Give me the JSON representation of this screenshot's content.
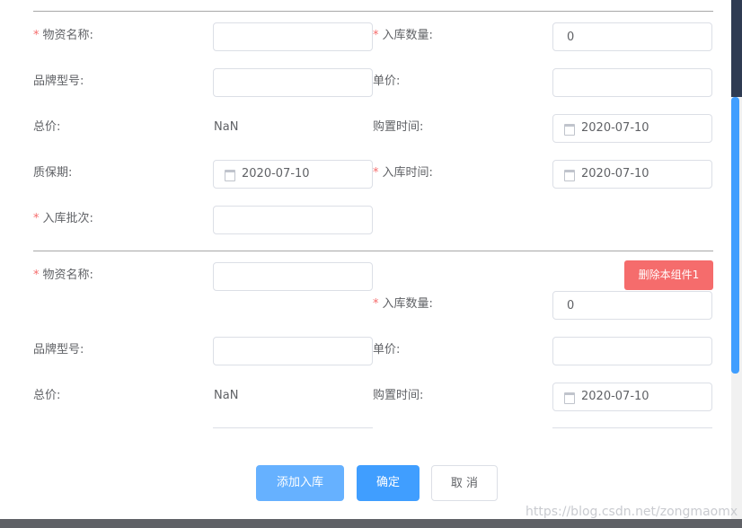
{
  "labels": {
    "name": "物资名称:",
    "qty": "入库数量:",
    "brand": "品牌型号:",
    "price": "单价:",
    "total": "总价:",
    "purchase_time": "购置时间:",
    "warranty": "质保期:",
    "stock_time": "入库时间:",
    "batch": "入库批次:",
    "required_mark": "*"
  },
  "group1": {
    "name": "",
    "qty": "0",
    "brand": "",
    "price": "",
    "total": "NaN",
    "purchase_time": "2020-07-10",
    "warranty": "2020-07-10",
    "stock_time": "2020-07-10",
    "batch": ""
  },
  "group2": {
    "delete_label": "删除本组件1",
    "name": "",
    "qty": "0",
    "brand": "",
    "price": "",
    "total": "NaN",
    "purchase_time": "2020-07-10"
  },
  "footer": {
    "add_label": "添加入库",
    "confirm_label": "确定",
    "cancel_label": "取 消"
  },
  "watermark": "https://blog.csdn.net/zongmaomx",
  "colors": {
    "primary": "#409eff",
    "primary_light": "#66b1ff",
    "danger": "#f56c6c",
    "required": "#f56c6c"
  }
}
